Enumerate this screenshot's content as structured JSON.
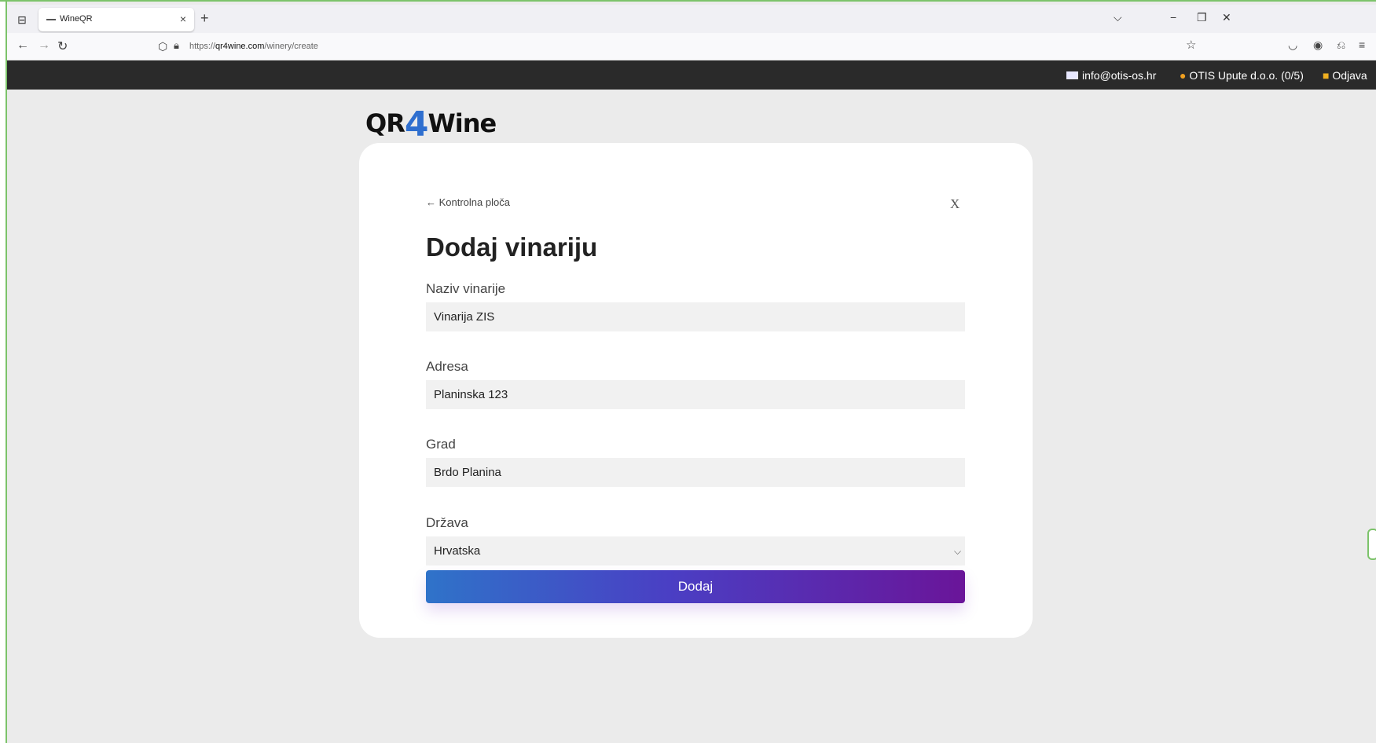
{
  "browser": {
    "tab_title": "WineQR",
    "url_prefix": "https://",
    "url_host": "qr4wine.com",
    "url_path": "/winery/create"
  },
  "icons": {
    "tab_list": "tab-list-icon",
    "close": "close-icon",
    "new_tab": "plus-icon",
    "back": "arrow-left-icon",
    "forward": "arrow-right-icon",
    "reload": "reload-icon",
    "shield": "shield-icon",
    "lock": "lock-icon",
    "bookmark": "star-icon",
    "pocket": "pocket-icon",
    "account": "account-icon",
    "extensions": "extensions-icon",
    "menu": "menu-icon",
    "email": "envelope-icon",
    "user": "user-icon",
    "logout": "lock-icon"
  },
  "site_bar": {
    "email": "info@otis-os.hr",
    "company": "OTIS Upute d.o.o. (0/5)",
    "logout": "Odjava"
  },
  "logo": {
    "left": "QR",
    "digit": "4",
    "right": "Wine"
  },
  "form": {
    "back_link": "← Kontrolna ploča",
    "close": "X",
    "title": "Dodaj vinariju",
    "fields": [
      {
        "label": "Naziv vinarije",
        "value": "Vinarija ZIS"
      },
      {
        "label": "Adresa",
        "value": "Planinska 123"
      },
      {
        "label": "Grad",
        "value": "Brdo Planina"
      },
      {
        "label": "Država",
        "value": "Hrvatska"
      }
    ],
    "submit": "Dodaj"
  },
  "colors": {
    "accent_start": "#2f73c9",
    "accent_end": "#6a1599",
    "site_bar_bg": "#2a2a2a",
    "logo_digit": "#2f6fcf"
  }
}
